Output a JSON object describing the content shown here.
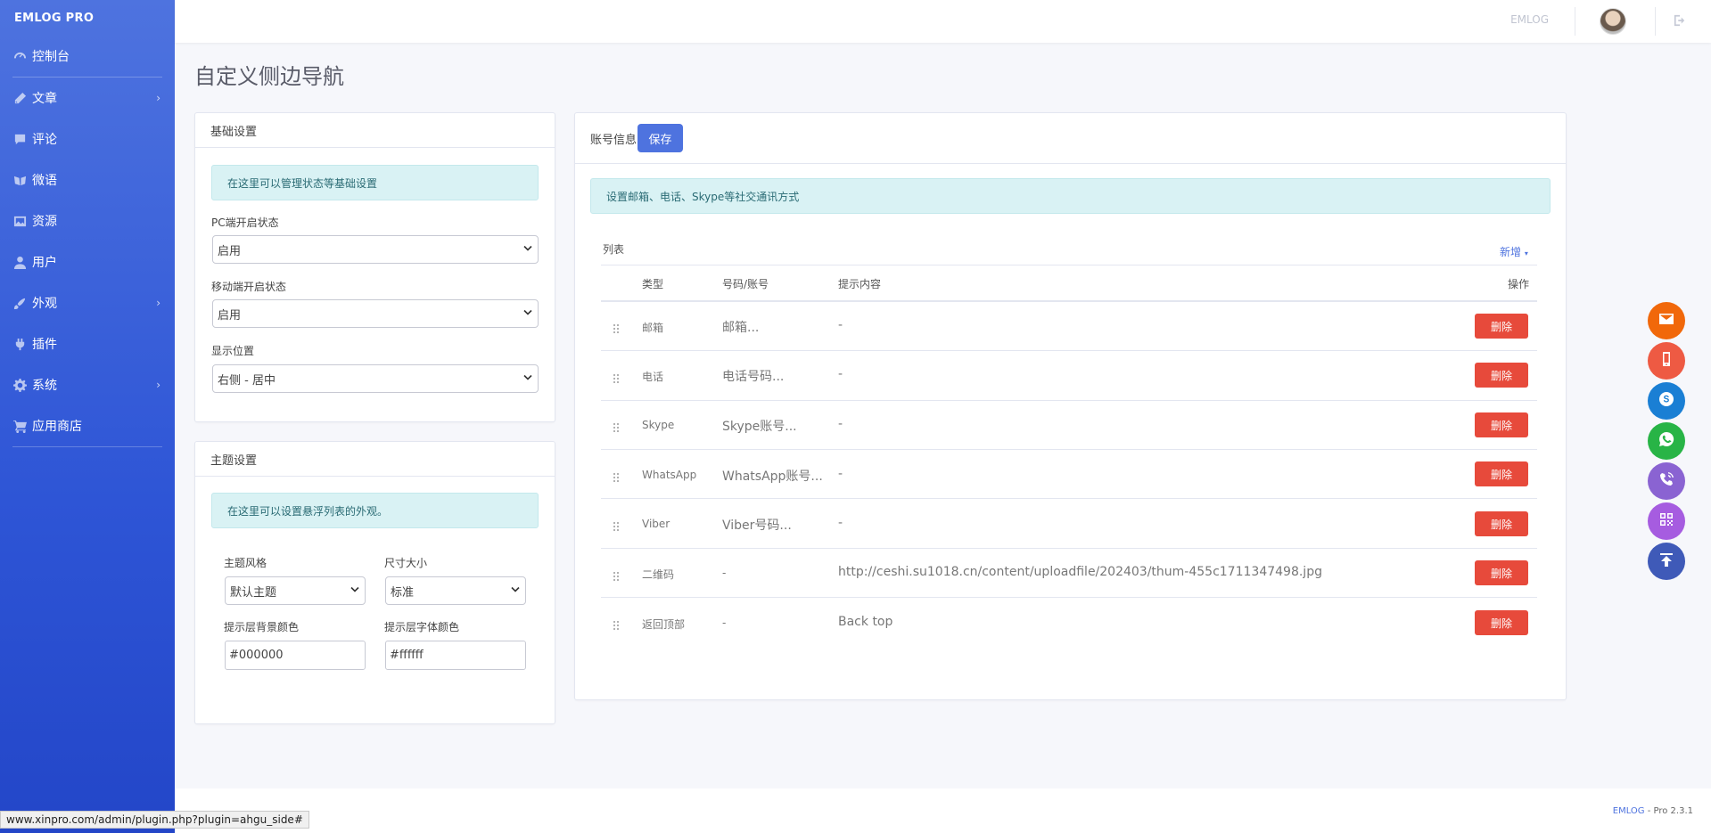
{
  "brand": "EMLOG PRO",
  "nav": [
    {
      "label": "控制台",
      "icon": "dashboard-icon",
      "chevron": false
    },
    {
      "label": "文章",
      "icon": "pencil-icon",
      "chevron": true
    },
    {
      "label": "评论",
      "icon": "comment-icon",
      "chevron": false
    },
    {
      "label": "微语",
      "icon": "twitter-icon",
      "chevron": false
    },
    {
      "label": "资源",
      "icon": "image-icon",
      "chevron": false
    },
    {
      "label": "用户",
      "icon": "user-icon",
      "chevron": false
    },
    {
      "label": "外观",
      "icon": "paint-icon",
      "chevron": true
    },
    {
      "label": "插件",
      "icon": "plug-icon",
      "chevron": false
    },
    {
      "label": "系统",
      "icon": "gear-icon",
      "chevron": true
    },
    {
      "label": "应用商店",
      "icon": "cart-icon",
      "chevron": false
    }
  ],
  "topbar": {
    "brand": "EMLOG"
  },
  "page": {
    "title": "自定义侧边导航"
  },
  "basic": {
    "title": "基础设置",
    "alert": "在这里可以管理状态等基础设置",
    "pc_label": "PC端开启状态",
    "pc_value": "启用",
    "mobile_label": "移动端开启状态",
    "mobile_value": "启用",
    "position_label": "显示位置",
    "position_value": "右侧 - 居中"
  },
  "theme": {
    "title": "主题设置",
    "alert": "在这里可以设置悬浮列表的外观。",
    "style_label": "主题风格",
    "style_value": "默认主题",
    "size_label": "尺寸大小",
    "size_value": "标准",
    "bg_label": "提示层背景颜色",
    "bg_value": "#000000",
    "font_label": "提示层字体颜色",
    "font_value": "#ffffff"
  },
  "account": {
    "title": "账号信息",
    "save": "保存",
    "alert": "设置邮箱、电话、Skype等社交通讯方式",
    "list_label": "列表",
    "new_label": "新增",
    "headers": {
      "type": "类型",
      "number": "号码/账号",
      "tip": "提示内容",
      "action": "操作"
    },
    "rows": [
      {
        "type": "邮箱",
        "number": "邮箱...",
        "tip": "-",
        "action": "删除"
      },
      {
        "type": "电话",
        "number": "电话号码...",
        "tip": "-",
        "action": "删除"
      },
      {
        "type": "Skype",
        "number": "Skype账号...",
        "tip": "-",
        "action": "删除"
      },
      {
        "type": "WhatsApp",
        "number": "WhatsApp账号...",
        "tip": "-",
        "action": "删除"
      },
      {
        "type": "Viber",
        "number": "Viber号码...",
        "tip": "-",
        "action": "删除"
      },
      {
        "type": "二维码",
        "number": "-",
        "tip": "http://ceshi.su1018.cn/content/uploadfile/202403/thum-455c1711347498.jpg",
        "action": "删除"
      },
      {
        "type": "返回顶部",
        "number": "-",
        "tip": "Back top",
        "action": "删除"
      }
    ]
  },
  "floating": [
    {
      "icon": "email-icon",
      "color": "#f1680a"
    },
    {
      "icon": "phone-icon",
      "color": "#ee5a43"
    },
    {
      "icon": "skype-icon",
      "color": "#1a7fd4"
    },
    {
      "icon": "whatsapp-icon",
      "color": "#28b446"
    },
    {
      "icon": "viber-icon",
      "color": "#8a63d2"
    },
    {
      "icon": "qrcode-icon",
      "color": "#a65ce0"
    },
    {
      "icon": "back-top-icon",
      "color": "#3f5ab8"
    }
  ],
  "footer": {
    "brand": "EMLOG",
    "version": " - Pro 2.3.1"
  },
  "statusbar": "www.xinpro.com/admin/plugin.php?plugin=ahgu_side#"
}
